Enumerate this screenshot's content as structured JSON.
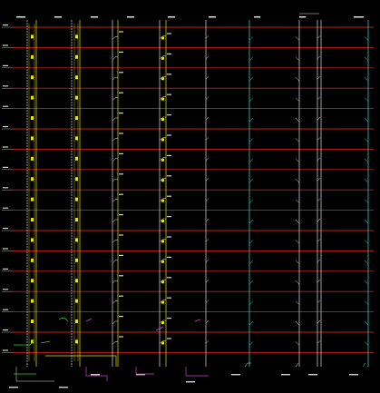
{
  "colors": {
    "background": "#000000",
    "floor_line": "#c81a1a",
    "riser_yellow": "#e6e600",
    "riser_white": "#e0e0e0",
    "riser_cyan": "#40e0e0",
    "riser_green": "#30d030",
    "riser_magenta": "#d040d0",
    "riser_orange": "#e07020"
  },
  "floor_count": 17,
  "riser_count": 14
}
